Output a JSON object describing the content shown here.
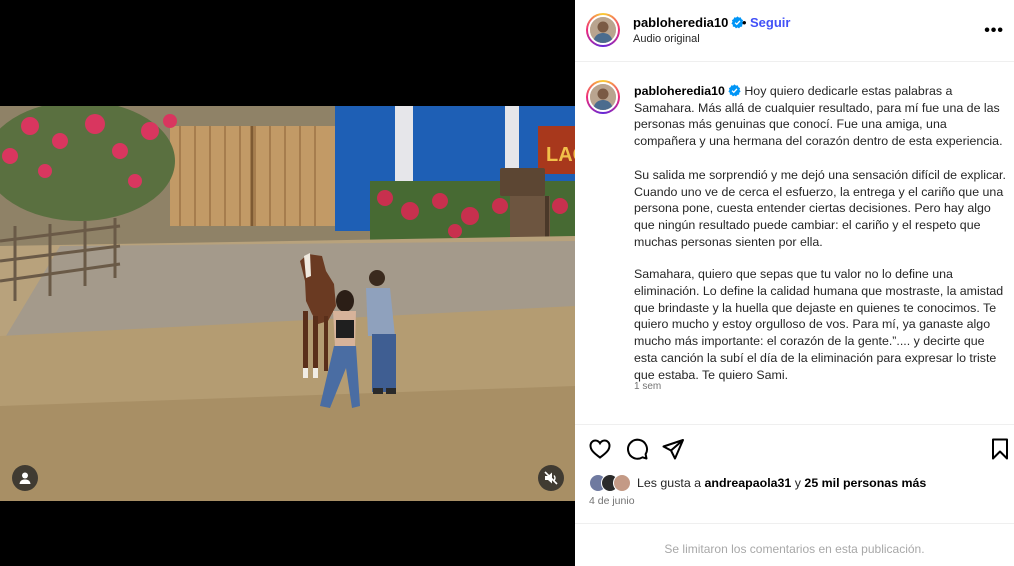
{
  "post": {
    "username": "pabloheredia10",
    "follow_label": "Seguir",
    "separator": "•",
    "audio_label": "Audio original",
    "more_label": "•••"
  },
  "caption": {
    "username": "pabloheredia10",
    "paragraph_1": "Hoy quiero dedicarle estas palabras a Samahara. Más allá de cualquier resultado, para mí fue una de las personas más genuinas que conocí. Fue una amiga, una compañera y una hermana del corazón dentro de esta experiencia.",
    "paragraph_2": "Su salida me sorprendió y me dejó una sensación difícil de explicar. Cuando uno ve de cerca el esfuerzo, la entrega y el cariño que una persona pone, cuesta entender ciertas decisiones. Pero hay algo que ningún resultado puede cambiar: el cariño y el respeto que muchas personas sienten por ella.",
    "paragraph_3": "Samahara, quiero que sepas que tu valor no lo define una eliminación. Lo define la calidad humana que mostraste, la amistad que brindaste y la huella que dejaste en quienes te conocimos. Te quiero mucho y estoy orgulloso de vos. Para mí, ya ganaste algo mucho más importante: el corazón de la gente.”.... y decirte que esta canción la subí el día de la eliminación para expresar lo triste que estaba. Te quiero Sami.",
    "time_ago": "1 sem"
  },
  "actions": {
    "like_icon": "heart-icon",
    "comment_icon": "comment-icon",
    "share_icon": "paper-plane-icon",
    "save_icon": "bookmark-icon"
  },
  "likes": {
    "prefix": "Les gusta a",
    "user": "andreapaola31",
    "connector": "y",
    "others": "25 mil personas más"
  },
  "date": "4 de junio",
  "comments_notice": "Se limitaron los comentarios en esta publicación.",
  "video": {
    "tag_icon": "user-tag-icon",
    "mute_icon": "muted-speaker-icon",
    "sign_text": "LAGRI"
  },
  "colors": {
    "follow_blue": "#4150f7",
    "verified_blue": "#0095f6",
    "muted_text": "#737373"
  }
}
